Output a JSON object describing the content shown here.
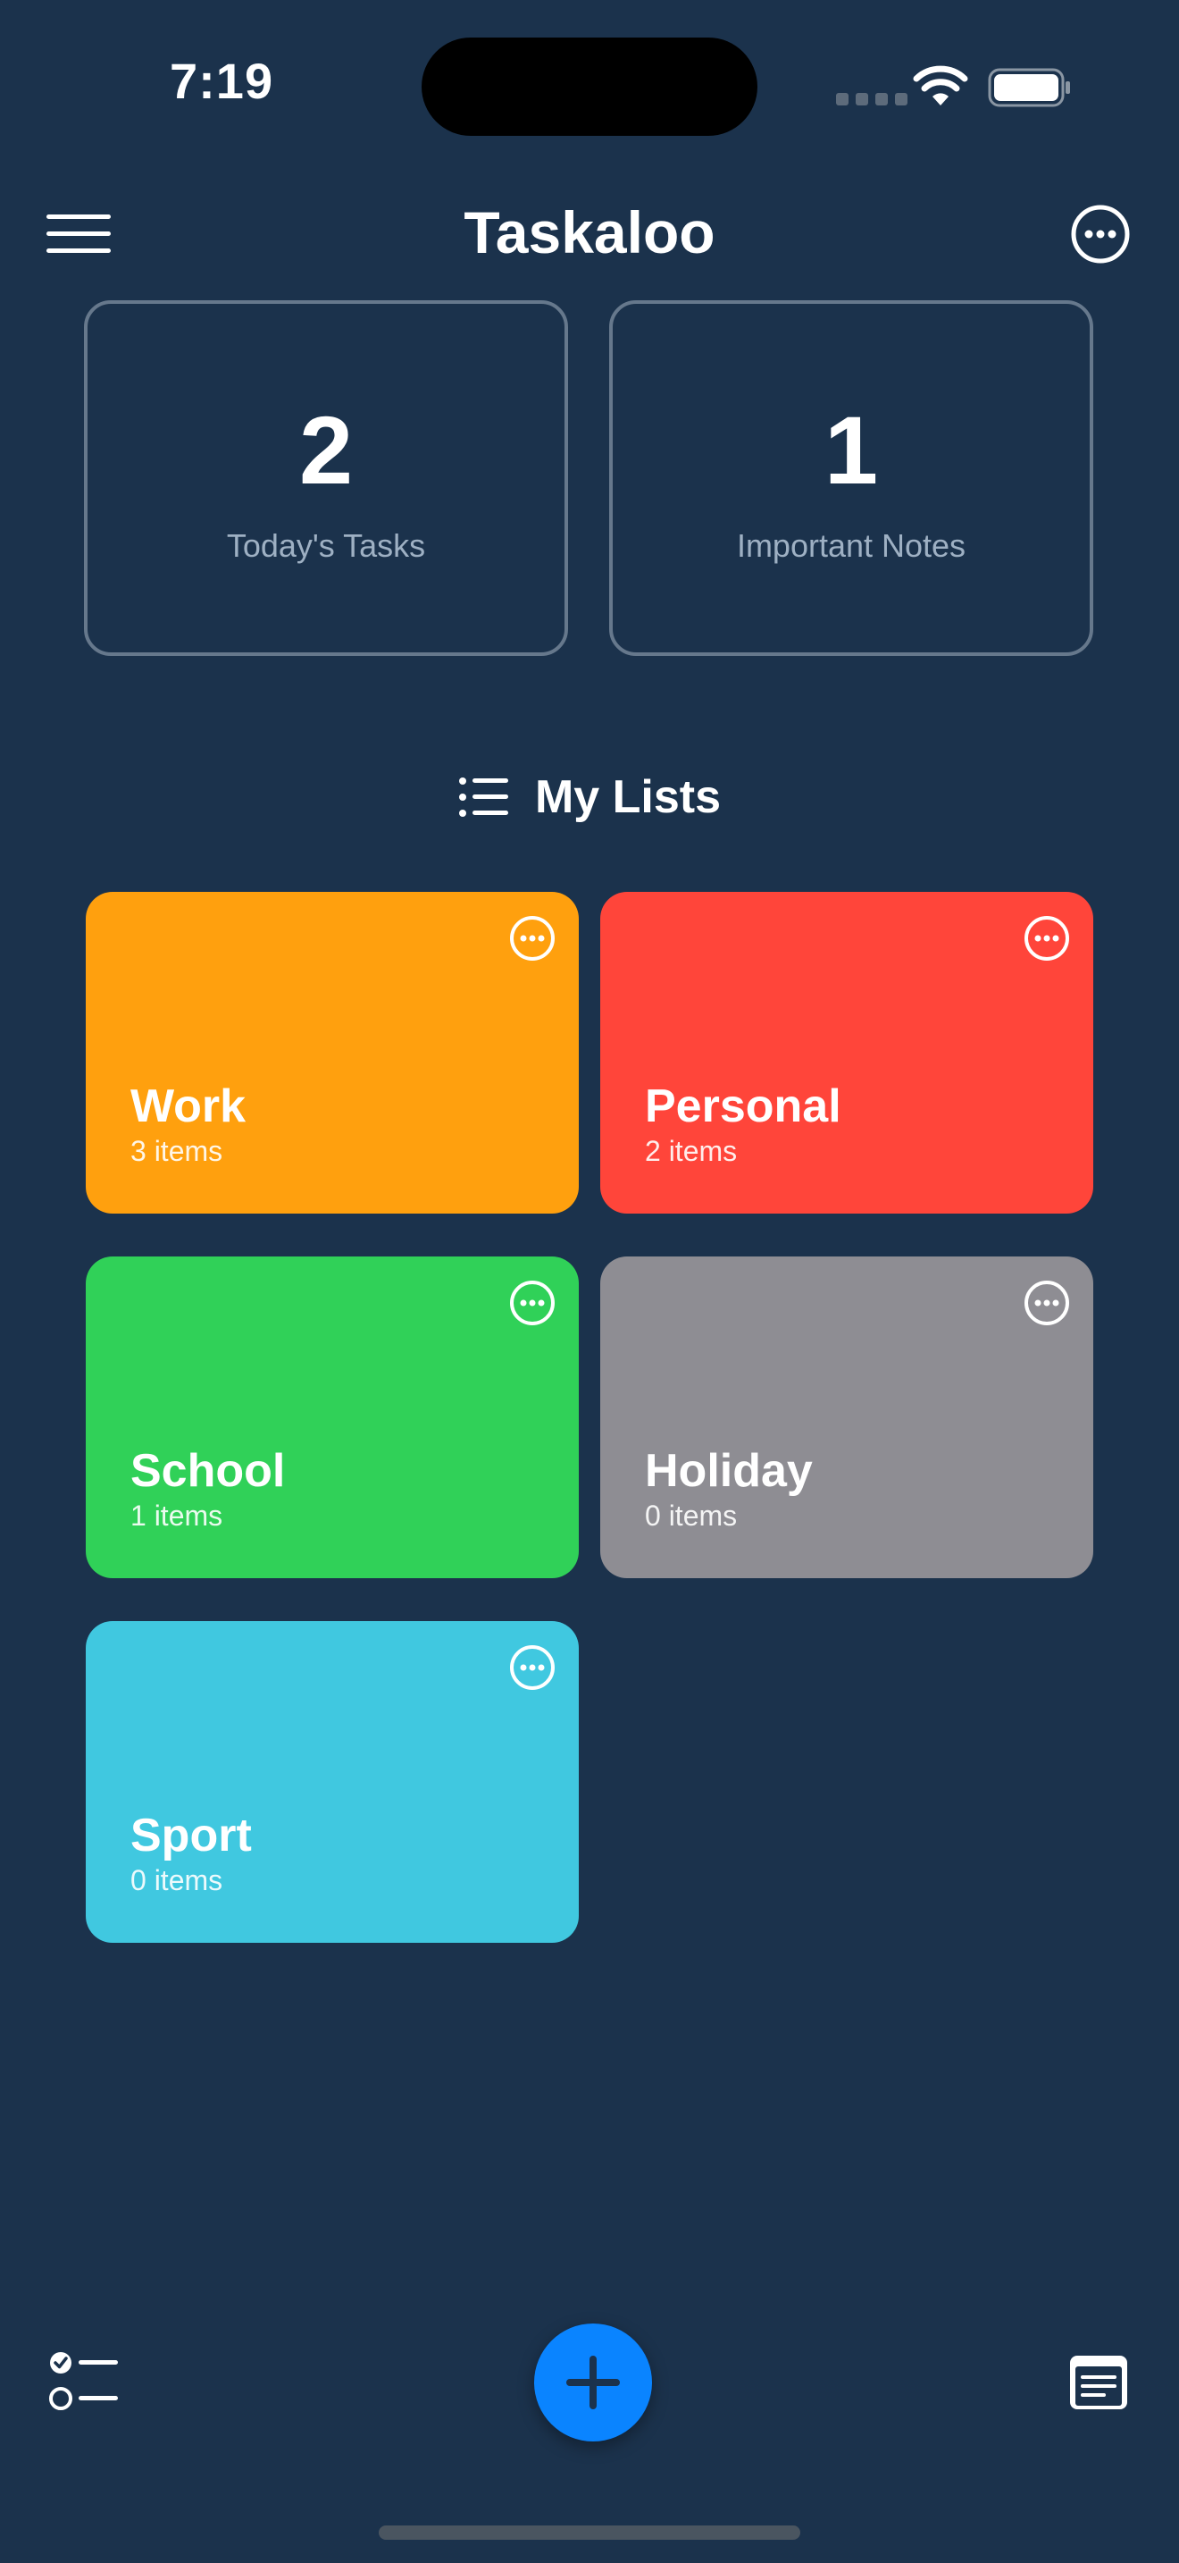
{
  "status_bar": {
    "time": "7:19"
  },
  "header": {
    "title": "Taskaloo",
    "menu_icon": "hamburger-menu-icon",
    "more_icon": "ellipsis-circle-icon"
  },
  "summary": [
    {
      "value": "2",
      "label": "Today's Tasks"
    },
    {
      "value": "1",
      "label": "Important Notes"
    }
  ],
  "lists_section": {
    "title": "My Lists",
    "icon": "list-bullet-icon"
  },
  "lists": [
    {
      "name": "Work",
      "count": "3 items",
      "color": "#ffa00e"
    },
    {
      "name": "Personal",
      "count": "2 items",
      "color": "#ff453a"
    },
    {
      "name": "School",
      "count": "1 items",
      "color": "#30d158"
    },
    {
      "name": "Holiday",
      "count": "0 items",
      "color": "#8e8d93"
    },
    {
      "name": "Sport",
      "count": "0 items",
      "color": "#40c8e0"
    }
  ],
  "bottom_bar": {
    "left_icon": "checklist-icon",
    "center_icon": "plus-icon",
    "right_icon": "note-icon",
    "accent": "#0a84ff"
  },
  "colors": {
    "background": "#1b324c",
    "card_border": "#66788c",
    "muted_text": "#9eb0c3"
  }
}
